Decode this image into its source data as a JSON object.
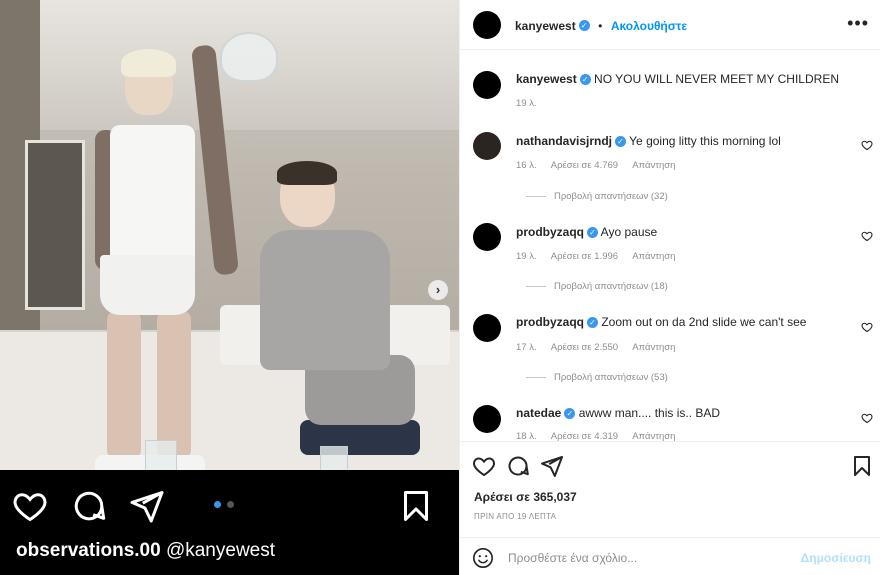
{
  "media": {
    "caption_user": "observations.00",
    "caption_mention": "@kanyewest",
    "slide_count": 2,
    "current_slide": 1
  },
  "post": {
    "author": "kanyewest",
    "separator": "•",
    "follow_label": "Ακολουθήστε",
    "more_label": "•••",
    "caption": "NO YOU WILL NEVER MEET MY CHILDREN",
    "caption_time": "19 λ."
  },
  "comments": [
    {
      "user": "nathandavisjrndj",
      "text": "Ye going litty this morning lol",
      "time": "16 λ.",
      "likes": "Αρέσει σε 4.769",
      "reply": "Απάντηση",
      "view_replies": "Προβολή απαντήσεων (32)"
    },
    {
      "user": "prodbyzaqq",
      "text": "Ayo pause",
      "time": "19 λ.",
      "likes": "Αρέσει σε 1.996",
      "reply": "Απάντηση",
      "view_replies": "Προβολή απαντήσεων (18)"
    },
    {
      "user": "prodbyzaqq",
      "text": "Zoom out on da 2nd slide we can't see",
      "time": "17 λ.",
      "likes": "Αρέσει σε 2.550",
      "reply": "Απάντηση",
      "view_replies": "Προβολή απαντήσεων (53)"
    },
    {
      "user": "natedae",
      "text": "awww man.... this is.. BAD",
      "time": "18 λ.",
      "likes": "Αρέσει σε 4.319",
      "reply": "Απάντηση",
      "view_replies": ""
    }
  ],
  "footer": {
    "likes": "Αρέσει σε 365,037",
    "time": "ΠΡΙΝ ΑΠΟ 19 ΛΕΠΤΑ",
    "comment_placeholder": "Προσθέστε ένα σχόλιο...",
    "publish_label": "Δημοσίευση"
  },
  "colors": {
    "accent": "#0095f6",
    "verified": "#3897f0",
    "muted": "#8e8e8e"
  },
  "icons": [
    "heart-icon",
    "comment-icon",
    "share-icon",
    "bookmark-icon",
    "verified-icon",
    "emoji-icon",
    "chevron-right-icon",
    "more-icon"
  ]
}
